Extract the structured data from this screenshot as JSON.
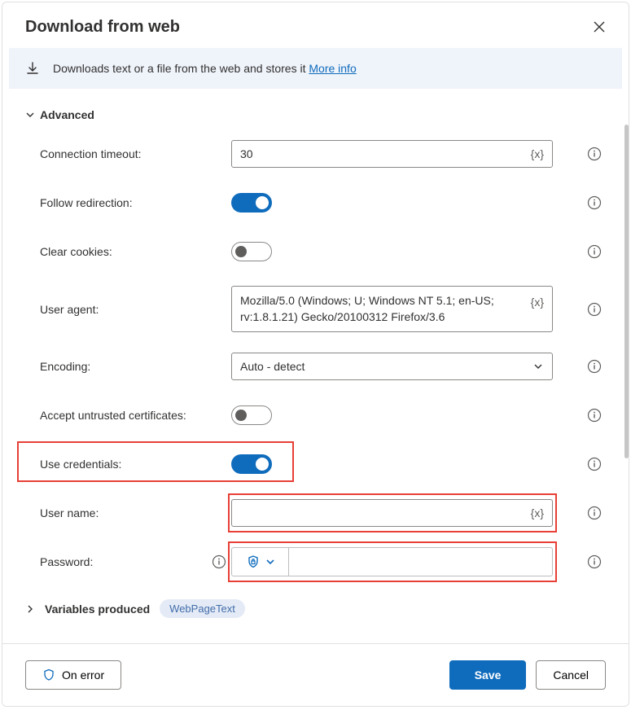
{
  "dialog": {
    "title": "Download from web",
    "banner_text": "Downloads text or a file from the web and stores it ",
    "banner_link": "More info"
  },
  "sections": {
    "advanced_label": "Advanced",
    "variables_label": "Variables produced",
    "variable_tag": "WebPageText"
  },
  "fields": {
    "connection_timeout": {
      "label": "Connection timeout:",
      "value": "30",
      "var_badge": "{x}"
    },
    "follow_redirection": {
      "label": "Follow redirection:"
    },
    "clear_cookies": {
      "label": "Clear cookies:"
    },
    "user_agent": {
      "label": "User agent:",
      "value": "Mozilla/5.0 (Windows; U; Windows NT 5.1; en-US; rv:1.8.1.21) Gecko/20100312 Firefox/3.6",
      "var_badge": "{x}"
    },
    "encoding": {
      "label": "Encoding:",
      "value": "Auto - detect"
    },
    "accept_untrusted": {
      "label": "Accept untrusted certificates:"
    },
    "use_credentials": {
      "label": "Use credentials:"
    },
    "user_name": {
      "label": "User name:",
      "value": "",
      "var_badge": "{x}"
    },
    "password": {
      "label": "Password:",
      "value": ""
    }
  },
  "footer": {
    "on_error": "On error",
    "save": "Save",
    "cancel": "Cancel"
  }
}
